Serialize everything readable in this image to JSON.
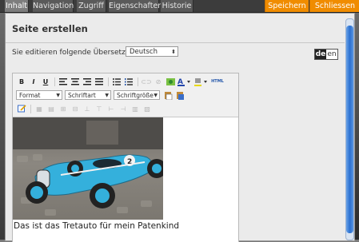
{
  "tabs": [
    "Inhalt",
    "Navigation",
    "Zugriff",
    "Eigenschaften",
    "Historie"
  ],
  "actions": {
    "save": "Speichern",
    "close": "Schliessen"
  },
  "dialog": {
    "title": "Seite erstellen",
    "translation_label": "Sie editieren folgende Übersetzung:",
    "translation_value": "Deutsch",
    "lang_active": "de",
    "lang_other": "en"
  },
  "toolbar": {
    "bold": "B",
    "italic": "I",
    "underline": "U",
    "html": "HTML",
    "format": "Format",
    "font": "Schriftart",
    "size": "Schriftgröße"
  },
  "content": {
    "caption": "Das ist das Tretauto für mein Patenkind"
  },
  "colors": {
    "accent": "#f08c00",
    "tab_bar": "#3c3c3c",
    "scroll_thumb": "#2a6fd0",
    "car": "#34b0dc"
  }
}
